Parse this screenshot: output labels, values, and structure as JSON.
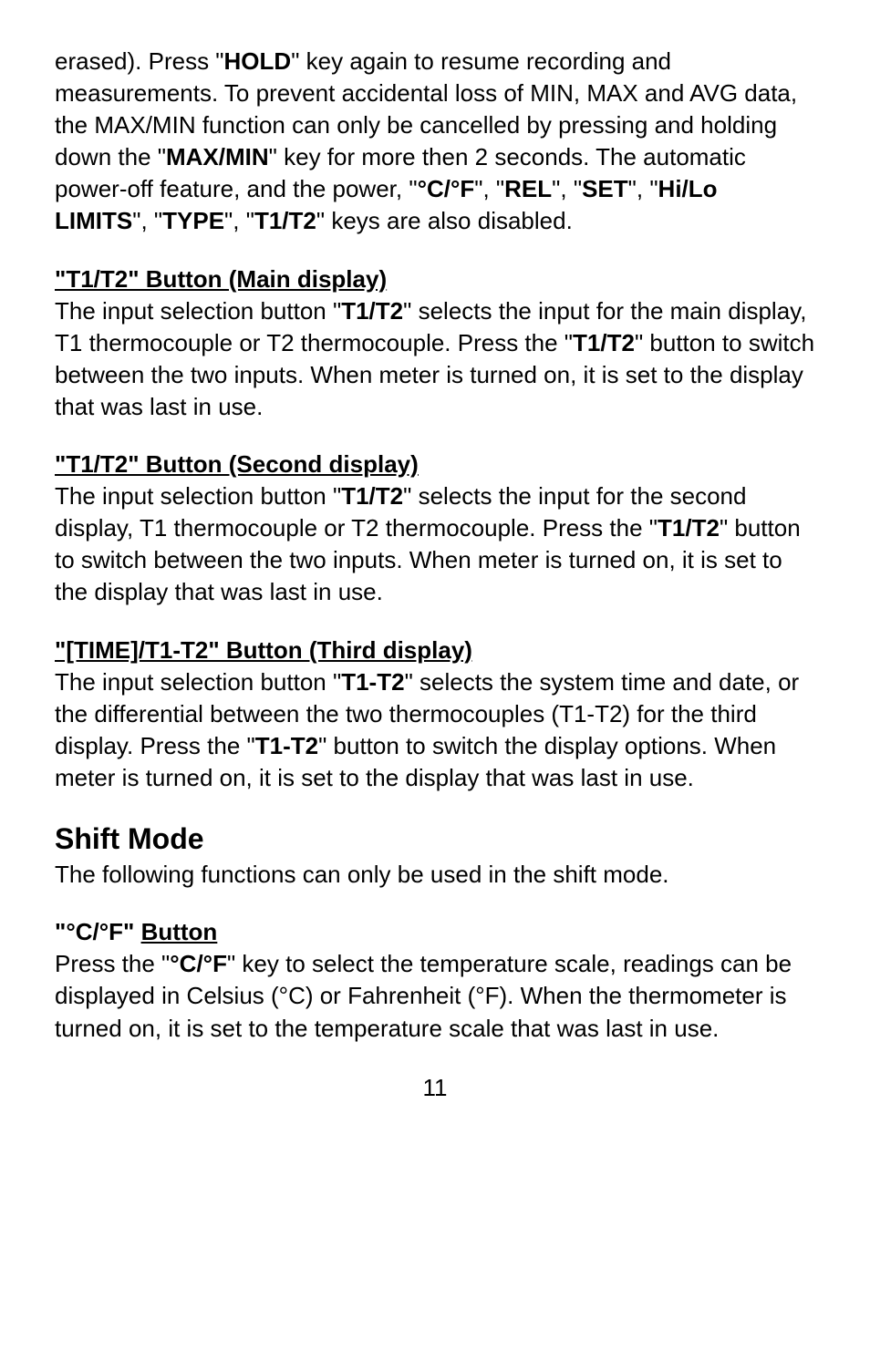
{
  "intro": {
    "seg1": "erased). Press \"",
    "hold": "HOLD",
    "seg2": "\" key again to resume recording and measurements. To prevent accidental loss of MIN, MAX and AVG data, the MAX/MIN function can only be cancelled by pressing and holding down the \"",
    "maxmin": "MAX/MIN",
    "seg3": "\" key for more then 2 seconds. The automatic power-off feature, and the power, \"",
    "cf": "°C/°F",
    "seg4": "\", \"",
    "rel": "REL",
    "seg5": "\", \"",
    "set": "SET",
    "seg6": "\", \"",
    "hilo": "Hi/Lo LIMITS",
    "seg7": "\", \"",
    "type": "TYPE",
    "seg8": "\", \"",
    "t1t2": "T1/T2",
    "seg9": "\" keys are also disabled."
  },
  "sec1": {
    "heading": "\"T1/T2\" Button (Main display)",
    "seg1": "The input selection button \"",
    "b1": "T1/T2",
    "seg2": "\" selects the input for the main display, T1 thermocouple or T2 thermocouple. Press the \"",
    "b2": "T1/T2",
    "seg3": "\" button to switch between the two inputs. When meter is turned on, it is set to the display that was last in use."
  },
  "sec2": {
    "heading": "\"T1/T2\" Button (Second display)",
    "seg1": "The input selection button \"",
    "b1": "T1/T2",
    "seg2": "\" selects the input for the second display, T1 thermocouple or T2 thermocouple. Press the \"",
    "b2": "T1/T2",
    "seg3": "\" button to switch between the two inputs. When meter is turned on, it is set to the display that was last in use."
  },
  "sec3": {
    "heading": "\"[TIME]/T1-T2\" Button (Third display)",
    "seg1": "The input selection button \"",
    "b1": "T1-T2",
    "seg2": "\" selects the system time and date, or the differential between the two thermocouples (T1-T2) for the third display. Press the \"",
    "b2": "T1-T2",
    "seg3": "\" button to switch the display options. When meter is turned on, it is set to the display that was last in use."
  },
  "shift": {
    "title": "Shift Mode",
    "body": "The following functions can only be used in the shift mode."
  },
  "sec4": {
    "hprefix": "\"°C/°F\" ",
    "hunder": "Button",
    "seg1": "Press the \"",
    "b1": "°C/°F",
    "seg2": "\" key to select the temperature scale, readings can be displayed in Celsius (°C) or Fahrenheit (°F). When the thermometer is turned on, it is set to the temperature scale that was last in use."
  },
  "page": "11"
}
